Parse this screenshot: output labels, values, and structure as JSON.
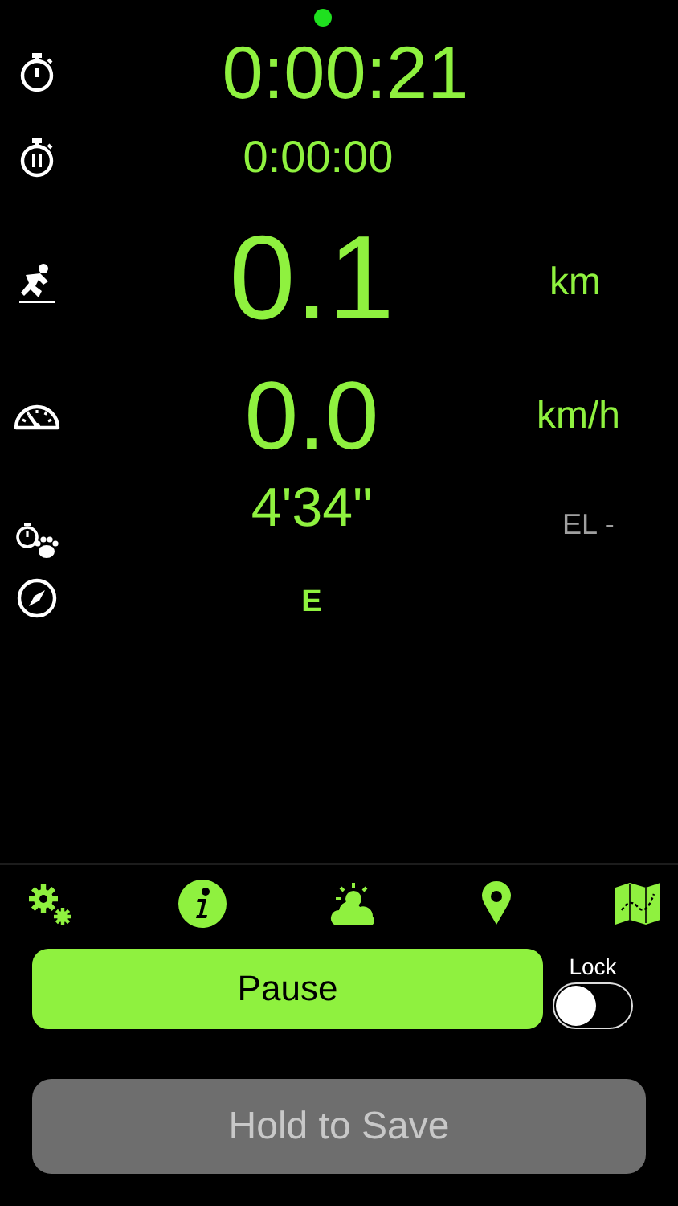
{
  "readings": [
    {
      "value": "0:00:21"
    },
    {
      "value": "0:00:00"
    },
    {
      "value": "0.1",
      "unit": "km"
    },
    {
      "value": "0.0",
      "unit": "km/h"
    },
    {
      "value": "4'34\"",
      "unit": "EL -"
    },
    {
      "value": "E"
    }
  ],
  "pause_button": "Pause",
  "lock": {
    "label": "Lock",
    "on": false
  },
  "save_button": "Hold to Save"
}
